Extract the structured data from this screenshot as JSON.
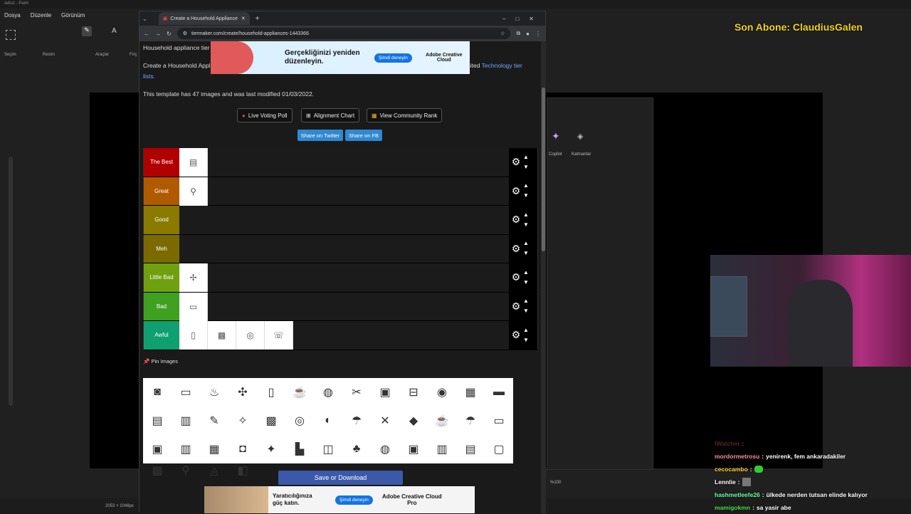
{
  "paint": {
    "title": "Adsız - Paint",
    "menu": [
      "Dosya",
      "Düzenle",
      "Görünüm"
    ],
    "ribbon_groups": [
      "Seçim",
      "Resim",
      "Araçlar",
      "Fırç"
    ],
    "status_size": "2053 × 1046px",
    "zoom": "%100",
    "panel_copilot": "Copilot",
    "panel_layers": "Katmanlar"
  },
  "overlay": {
    "subscriber_text": "Son Abone: ClaudiusGalen"
  },
  "browser": {
    "tab_title": "Create a Household Appliance",
    "url": "tiermaker.com/create/household-appliances-1443366"
  },
  "page": {
    "intro_line1": "Household appliance tier",
    "intro_line2_a": "Create a Household Appli",
    "intro_line2_link": "Technology tier",
    "intro_line2_b": "lists",
    "intro_line2_mid": "nited",
    "template_info": "This template has 47 images and was last modified 01/03/2022.",
    "buttons": {
      "live_poll": "Live Voting Poll",
      "alignment": "Alignment Chart",
      "community": "View Community Rank",
      "share_twitter": "Share on Twitter",
      "share_fb": "Share on FB"
    },
    "pin_images": "Pin Images",
    "save": "Save or Download"
  },
  "tiers": [
    {
      "label": "The Best",
      "color": "#b00000",
      "items": [
        "AC"
      ]
    },
    {
      "label": "Great",
      "color": "#b05a00",
      "items": [
        "WC"
      ]
    },
    {
      "label": "Good",
      "color": "#8a7a00",
      "items": []
    },
    {
      "label": "Meh",
      "color": "#7a6a00",
      "items": []
    },
    {
      "label": "Little Bad",
      "color": "#70a010",
      "items": [
        "Fan"
      ]
    },
    {
      "label": "Bad",
      "color": "#40a020",
      "items": [
        "Print"
      ]
    },
    {
      "label": "Awful",
      "color": "#10a070",
      "items": [
        "Fridge",
        "Stove",
        "Wash",
        "Phone"
      ]
    }
  ],
  "ads": {
    "top_text": "Gerçekliğinizi yeniden düzenleyin.",
    "top_cta": "Şimdi deneyin",
    "top_brand": "Adobe Creative Cloud",
    "bottom_text": "Yaratıcılığınıza güç katın.",
    "bottom_cta": "Şimdi deneyin",
    "bottom_brand": "Adobe Creative Cloud Pro"
  },
  "chat": [
    {
      "user": "mordormetrosu",
      "color": "#ff8aa0",
      "msg": "yenirenk, fem ankaradakiler"
    },
    {
      "user": "cecocambo",
      "color": "#ffd23f",
      "msg": ""
    },
    {
      "user": "Lennlie",
      "color": "#ffffff",
      "msg": ""
    },
    {
      "user": "hashmetleefe26",
      "color": "#6fffaa",
      "msg": "ülkede nerden tutsan elinde kalıyor"
    },
    {
      "user": "mamigokmn",
      "color": "#50e050",
      "msg": "sa yasir abe"
    }
  ]
}
